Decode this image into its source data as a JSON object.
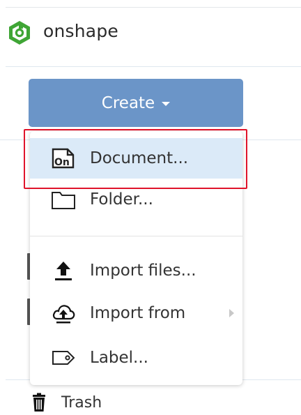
{
  "header": {
    "brand": "onshape",
    "logo_icon": "onshape-logo-icon",
    "brand_color": "#3fa535"
  },
  "create_button": {
    "label": "Create",
    "icon": "caret-down-icon",
    "color": "#6b95c8"
  },
  "menu": {
    "items": [
      {
        "label": "Document...",
        "icon": "onshape-document-icon",
        "highlighted": true
      },
      {
        "label": "Folder...",
        "icon": "folder-icon"
      },
      {
        "label": "Import files...",
        "icon": "upload-icon"
      },
      {
        "label": "Import from",
        "icon": "cloud-upload-icon",
        "has_submenu": true
      },
      {
        "label": "Label...",
        "icon": "tag-icon"
      }
    ]
  },
  "sidebar": {
    "trash_label": "Trash",
    "trash_icon": "trash-icon"
  },
  "annotation": {
    "highlight_color": "#e0142b"
  }
}
